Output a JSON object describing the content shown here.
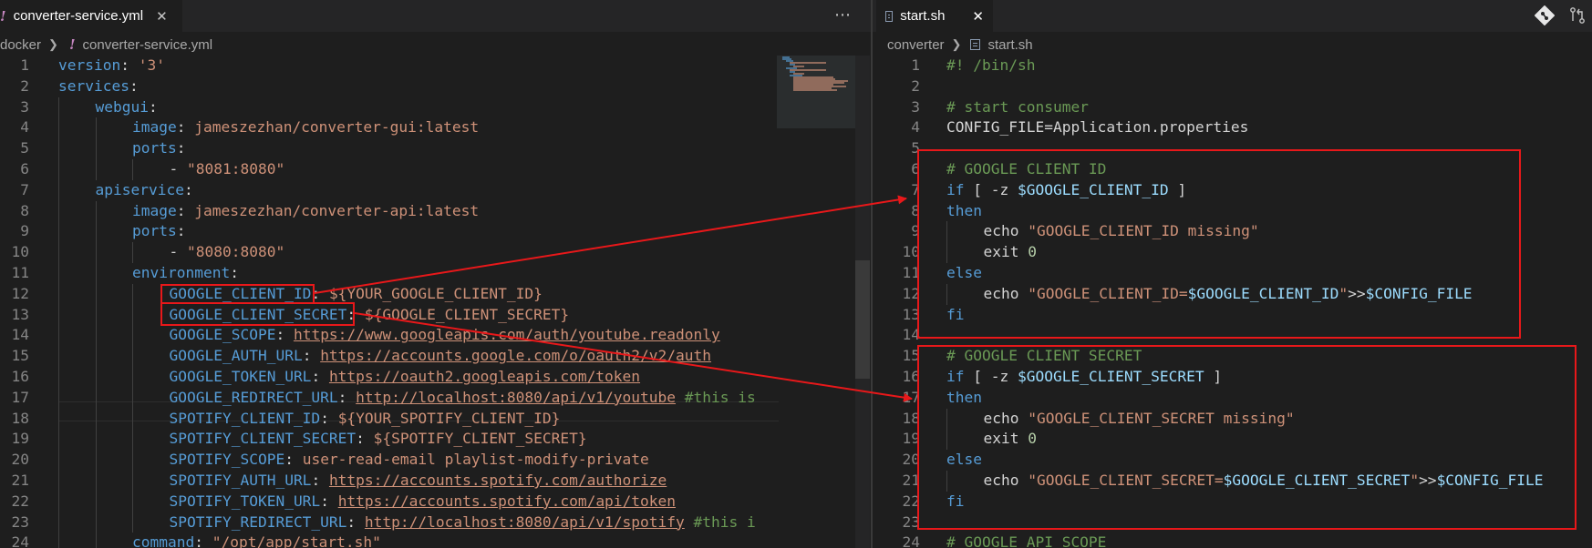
{
  "left": {
    "tab": {
      "icon": "!",
      "title": "converter-service.yml",
      "close": "✕"
    },
    "more_icon": "⋯",
    "breadcrumb": {
      "folder": "docker",
      "icon": "!",
      "file": "converter-service.yml"
    }
  },
  "right": {
    "tab": {
      "title": "start.sh",
      "close": "✕"
    },
    "breadcrumb": {
      "folder": "converter",
      "file": "start.sh"
    }
  },
  "yaml_lines": [
    {
      "n": "1",
      "indent": 0,
      "parts": [
        {
          "t": "version",
          "c": "k"
        },
        {
          "t": ": ",
          "c": "w"
        },
        {
          "t": "'3'",
          "c": "s"
        }
      ]
    },
    {
      "n": "2",
      "indent": 0,
      "parts": [
        {
          "t": "services",
          "c": "k"
        },
        {
          "t": ":",
          "c": "w"
        }
      ]
    },
    {
      "n": "3",
      "indent": 1,
      "parts": [
        {
          "t": "webgui",
          "c": "k"
        },
        {
          "t": ":",
          "c": "w"
        }
      ]
    },
    {
      "n": "4",
      "indent": 2,
      "parts": [
        {
          "t": "image",
          "c": "k"
        },
        {
          "t": ": ",
          "c": "w"
        },
        {
          "t": "jameszezhan/converter-gui:latest",
          "c": "s"
        }
      ]
    },
    {
      "n": "5",
      "indent": 2,
      "parts": [
        {
          "t": "ports",
          "c": "k"
        },
        {
          "t": ":",
          "c": "w"
        }
      ]
    },
    {
      "n": "6",
      "indent": 3,
      "parts": [
        {
          "t": "- ",
          "c": "w"
        },
        {
          "t": "\"8081:8080\"",
          "c": "s"
        }
      ]
    },
    {
      "n": "7",
      "indent": 1,
      "parts": [
        {
          "t": "apiservice",
          "c": "k"
        },
        {
          "t": ":",
          "c": "w"
        }
      ]
    },
    {
      "n": "8",
      "indent": 2,
      "parts": [
        {
          "t": "image",
          "c": "k"
        },
        {
          "t": ": ",
          "c": "w"
        },
        {
          "t": "jameszezhan/converter-api:latest",
          "c": "s"
        }
      ]
    },
    {
      "n": "9",
      "indent": 2,
      "parts": [
        {
          "t": "ports",
          "c": "k"
        },
        {
          "t": ":",
          "c": "w"
        }
      ]
    },
    {
      "n": "10",
      "indent": 3,
      "parts": [
        {
          "t": "- ",
          "c": "w"
        },
        {
          "t": "\"8080:8080\"",
          "c": "s"
        }
      ]
    },
    {
      "n": "11",
      "indent": 2,
      "parts": [
        {
          "t": "environment",
          "c": "k"
        },
        {
          "t": ":",
          "c": "w"
        }
      ]
    },
    {
      "n": "12",
      "indent": 3,
      "parts": [
        {
          "t": "GOOGLE_CLIENT_ID",
          "c": "k"
        },
        {
          "t": ": ",
          "c": "w"
        },
        {
          "t": "${YOUR_GOOGLE_CLIENT_ID}",
          "c": "s"
        }
      ]
    },
    {
      "n": "13",
      "indent": 3,
      "parts": [
        {
          "t": "GOOGLE_CLIENT_SECRET",
          "c": "k"
        },
        {
          "t": ": ",
          "c": "w"
        },
        {
          "t": "${GOOGLE_CLIENT_SECRET}",
          "c": "s"
        }
      ]
    },
    {
      "n": "14",
      "indent": 3,
      "parts": [
        {
          "t": "GOOGLE_SCOPE",
          "c": "k"
        },
        {
          "t": ": ",
          "c": "w"
        },
        {
          "t": "https://www.googleapis.com/auth/youtube.readonly",
          "c": "u"
        }
      ]
    },
    {
      "n": "15",
      "indent": 3,
      "parts": [
        {
          "t": "GOOGLE_AUTH_URL",
          "c": "k"
        },
        {
          "t": ": ",
          "c": "w"
        },
        {
          "t": "https://accounts.google.com/o/oauth2/v2/auth",
          "c": "u"
        }
      ]
    },
    {
      "n": "16",
      "indent": 3,
      "parts": [
        {
          "t": "GOOGLE_TOKEN_URL",
          "c": "k"
        },
        {
          "t": ": ",
          "c": "w"
        },
        {
          "t": "https://oauth2.googleapis.com/token",
          "c": "u"
        }
      ]
    },
    {
      "n": "17",
      "indent": 3,
      "parts": [
        {
          "t": "GOOGLE_REDIRECT_URL",
          "c": "k"
        },
        {
          "t": ": ",
          "c": "w"
        },
        {
          "t": "http://localhost:8080/api/v1/youtube",
          "c": "u"
        },
        {
          "t": " #this is",
          "c": "c"
        }
      ]
    },
    {
      "n": "18",
      "indent": 3,
      "parts": [
        {
          "t": "SPOTIFY_CLIENT_ID",
          "c": "k"
        },
        {
          "t": ": ",
          "c": "w"
        },
        {
          "t": "${YOUR_SPOTIFY_CLIENT_ID}",
          "c": "s"
        }
      ]
    },
    {
      "n": "19",
      "indent": 3,
      "parts": [
        {
          "t": "SPOTIFY_CLIENT_SECRET",
          "c": "k"
        },
        {
          "t": ": ",
          "c": "w"
        },
        {
          "t": "${SPOTIFY_CLIENT_SECRET}",
          "c": "s"
        }
      ]
    },
    {
      "n": "20",
      "indent": 3,
      "parts": [
        {
          "t": "SPOTIFY_SCOPE",
          "c": "k"
        },
        {
          "t": ": ",
          "c": "w"
        },
        {
          "t": "user-read-email playlist-modify-private",
          "c": "s"
        }
      ]
    },
    {
      "n": "21",
      "indent": 3,
      "parts": [
        {
          "t": "SPOTIFY_AUTH_URL",
          "c": "k"
        },
        {
          "t": ": ",
          "c": "w"
        },
        {
          "t": "https://accounts.spotify.com/authorize",
          "c": "u"
        }
      ]
    },
    {
      "n": "22",
      "indent": 3,
      "parts": [
        {
          "t": "SPOTIFY_TOKEN_URL",
          "c": "k"
        },
        {
          "t": ": ",
          "c": "w"
        },
        {
          "t": "https://accounts.spotify.com/api/token",
          "c": "u"
        }
      ]
    },
    {
      "n": "23",
      "indent": 3,
      "parts": [
        {
          "t": "SPOTIFY_REDIRECT_URL",
          "c": "k"
        },
        {
          "t": ": ",
          "c": "w"
        },
        {
          "t": "http://localhost:8080/api/v1/spotify",
          "c": "u"
        },
        {
          "t": " #this i",
          "c": "c"
        }
      ]
    },
    {
      "n": "24",
      "indent": 2,
      "parts": [
        {
          "t": "command",
          "c": "k"
        },
        {
          "t": ": ",
          "c": "w"
        },
        {
          "t": "\"/opt/app/start.sh\"",
          "c": "s"
        }
      ]
    }
  ],
  "sh_lines": [
    {
      "n": "1",
      "indent": 0,
      "parts": [
        {
          "t": "#! /bin/sh",
          "c": "c"
        }
      ]
    },
    {
      "n": "2",
      "indent": 0,
      "parts": []
    },
    {
      "n": "3",
      "indent": 0,
      "parts": [
        {
          "t": "# start consumer",
          "c": "c"
        }
      ]
    },
    {
      "n": "4",
      "indent": 0,
      "parts": [
        {
          "t": "CONFIG_FILE=Application.properties",
          "c": "w"
        }
      ]
    },
    {
      "n": "5",
      "indent": 0,
      "parts": []
    },
    {
      "n": "6",
      "indent": 0,
      "parts": [
        {
          "t": "# GOOGLE CLIENT ID",
          "c": "c"
        }
      ]
    },
    {
      "n": "7",
      "indent": 0,
      "parts": [
        {
          "t": "if",
          "c": "k"
        },
        {
          "t": " [ -z ",
          "c": "w"
        },
        {
          "t": "$GOOGLE_CLIENT_ID",
          "c": "v"
        },
        {
          "t": " ]",
          "c": "w"
        }
      ]
    },
    {
      "n": "8",
      "indent": 0,
      "parts": [
        {
          "t": "then",
          "c": "k"
        }
      ]
    },
    {
      "n": "9",
      "indent": 1,
      "parts": [
        {
          "t": "echo ",
          "c": "w"
        },
        {
          "t": "\"GOOGLE_CLIENT_ID missing\"",
          "c": "s"
        }
      ]
    },
    {
      "n": "10",
      "indent": 1,
      "parts": [
        {
          "t": "exit ",
          "c": "w"
        },
        {
          "t": "0",
          "c": "n"
        }
      ]
    },
    {
      "n": "11",
      "indent": 0,
      "parts": [
        {
          "t": "else",
          "c": "k"
        }
      ]
    },
    {
      "n": "12",
      "indent": 1,
      "parts": [
        {
          "t": "echo ",
          "c": "w"
        },
        {
          "t": "\"GOOGLE_CLIENT_ID=",
          "c": "s"
        },
        {
          "t": "$GOOGLE_CLIENT_ID",
          "c": "v"
        },
        {
          "t": "\"",
          "c": "s"
        },
        {
          "t": ">>",
          "c": "w"
        },
        {
          "t": "$CONFIG_FILE",
          "c": "v"
        }
      ]
    },
    {
      "n": "13",
      "indent": 0,
      "parts": [
        {
          "t": "fi",
          "c": "k"
        }
      ]
    },
    {
      "n": "14",
      "indent": 0,
      "parts": []
    },
    {
      "n": "15",
      "indent": 0,
      "parts": [
        {
          "t": "# GOOGLE CLIENT SECRET",
          "c": "c"
        }
      ]
    },
    {
      "n": "16",
      "indent": 0,
      "parts": [
        {
          "t": "if",
          "c": "k"
        },
        {
          "t": " [ -z ",
          "c": "w"
        },
        {
          "t": "$GOOGLE_CLIENT_SECRET",
          "c": "v"
        },
        {
          "t": " ]",
          "c": "w"
        }
      ]
    },
    {
      "n": "17",
      "indent": 0,
      "parts": [
        {
          "t": "then",
          "c": "k"
        }
      ]
    },
    {
      "n": "18",
      "indent": 1,
      "parts": [
        {
          "t": "echo ",
          "c": "w"
        },
        {
          "t": "\"GOOGLE_CLIENT_SECRET missing\"",
          "c": "s"
        }
      ]
    },
    {
      "n": "19",
      "indent": 1,
      "parts": [
        {
          "t": "exit ",
          "c": "w"
        },
        {
          "t": "0",
          "c": "n"
        }
      ]
    },
    {
      "n": "20",
      "indent": 0,
      "parts": [
        {
          "t": "else",
          "c": "k"
        }
      ]
    },
    {
      "n": "21",
      "indent": 1,
      "parts": [
        {
          "t": "echo ",
          "c": "w"
        },
        {
          "t": "\"GOOGLE_CLIENT_SECRET=",
          "c": "s"
        },
        {
          "t": "$GOOGLE_CLIENT_SECRET",
          "c": "v"
        },
        {
          "t": "\"",
          "c": "s"
        },
        {
          "t": ">>",
          "c": "w"
        },
        {
          "t": "$CONFIG_FILE",
          "c": "v"
        }
      ]
    },
    {
      "n": "22",
      "indent": 0,
      "parts": [
        {
          "t": "fi",
          "c": "k"
        }
      ]
    },
    {
      "n": "23",
      "indent": 0,
      "parts": []
    },
    {
      "n": "24",
      "indent": 0,
      "parts": [
        {
          "t": "# GOOGLE API SCOPE",
          "c": "c"
        }
      ]
    }
  ],
  "annotations": {
    "color": "#e8181a"
  }
}
